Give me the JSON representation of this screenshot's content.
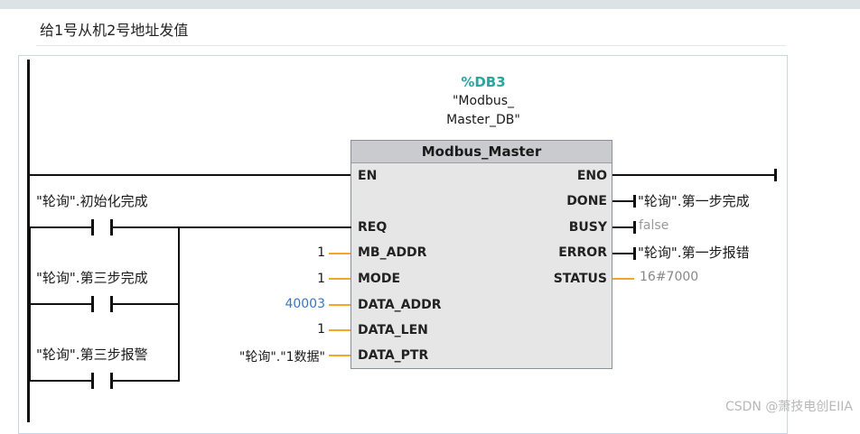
{
  "network": {
    "comment": "给1号从机2号地址发值",
    "db_name": "%DB3",
    "db_label": "\"Modbus_",
    "db_label2": "Master_DB\""
  },
  "block": {
    "title": "Modbus_Master",
    "inputs": [
      "EN",
      "REQ",
      "MB_ADDR",
      "MODE",
      "DATA_ADDR",
      "DATA_LEN",
      "DATA_PTR"
    ],
    "outputs": [
      "ENO",
      "DONE",
      "BUSY",
      "ERROR",
      "STATUS"
    ]
  },
  "params": {
    "mb_addr": "1",
    "mode": "1",
    "data_addr": "40003",
    "data_len": "1",
    "data_ptr": "\"轮询\".\"1数据\""
  },
  "outputs": {
    "done_tag": "\"轮询\".第一步完成",
    "busy_val": "false",
    "error_tag": "\"轮询\".第一步报错",
    "status_val": "16#7000"
  },
  "contacts": [
    "\"轮询\".初始化完成",
    "\"轮询\".第三步完成",
    "\"轮询\".第三步报警"
  ],
  "watermark": "CSDN @萧技电创EIIA"
}
